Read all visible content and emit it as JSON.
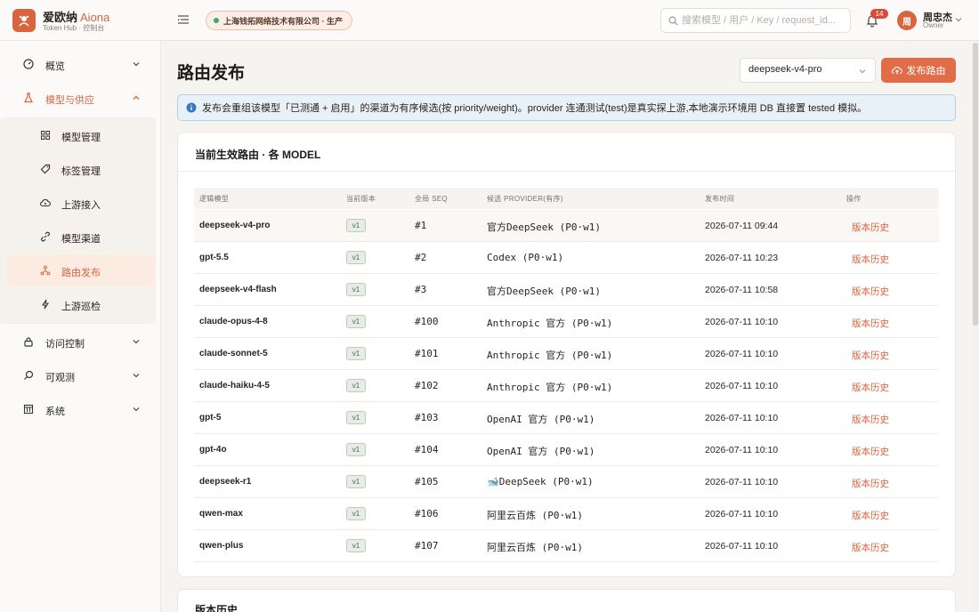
{
  "app": {
    "brand_cn": "爱欧纳",
    "brand_en": "Aiona",
    "subtitle": "Token Hub · 控制台"
  },
  "header": {
    "env_label": "上海钱拓网络技术有限公司 · 生产",
    "search_placeholder": "搜索模型 / 用户 / Key / request_id...",
    "notification_count": "14",
    "user_initial": "周",
    "user_name": "周忠杰",
    "user_role": "Owner"
  },
  "sidebar": {
    "items": [
      {
        "label": "概览",
        "icon": "dashboard-icon"
      },
      {
        "label": "模型与供应",
        "icon": "flask-icon"
      },
      {
        "label": "访问控制",
        "icon": "lock-icon"
      },
      {
        "label": "可观测",
        "icon": "search-icon"
      },
      {
        "label": "系统",
        "icon": "grid-icon"
      }
    ],
    "sub_items": [
      {
        "label": "模型管理",
        "icon": "grid-icon"
      },
      {
        "label": "标签管理",
        "icon": "tag-icon"
      },
      {
        "label": "上游接入",
        "icon": "cloud-icon"
      },
      {
        "label": "模型渠道",
        "icon": "link-icon"
      },
      {
        "label": "路由发布",
        "icon": "route-icon"
      },
      {
        "label": "上游巡检",
        "icon": "bolt-icon"
      }
    ]
  },
  "main": {
    "title": "路由发布",
    "selected_model": "deepseek-v4-pro",
    "publish_label": "发布路由",
    "info_text": "发布会重组该模型「已测通 + 启用」的渠道为有序候选(按 priority/weight)。provider 连通测试(test)是真实探上游,本地演示环境用 DB 直接置 tested 模拟。",
    "card_title": "当前生效路由 · 各 MODEL",
    "columns": [
      "逻辑模型",
      "当前版本",
      "全局 SEQ",
      "候选 PROVIDER(有序)",
      "发布时间",
      "操作"
    ],
    "rows": [
      {
        "model": "deepseek-v4-pro",
        "version": "v1",
        "seq": "#1",
        "provider": "官方DeepSeek (P0·w1)",
        "time": "2026-07-11 09:44",
        "action": "版本历史"
      },
      {
        "model": "gpt-5.5",
        "version": "v1",
        "seq": "#2",
        "provider": "Codex (P0·w1)",
        "time": "2026-07-11 10:23",
        "action": "版本历史"
      },
      {
        "model": "deepseek-v4-flash",
        "version": "v1",
        "seq": "#3",
        "provider": "官方DeepSeek (P0·w1)",
        "time": "2026-07-11 10:58",
        "action": "版本历史"
      },
      {
        "model": "claude-opus-4-8",
        "version": "v1",
        "seq": "#100",
        "provider": "Anthropic 官方 (P0·w1)",
        "time": "2026-07-11 10:10",
        "action": "版本历史"
      },
      {
        "model": "claude-sonnet-5",
        "version": "v1",
        "seq": "#101",
        "provider": "Anthropic 官方 (P0·w1)",
        "time": "2026-07-11 10:10",
        "action": "版本历史"
      },
      {
        "model": "claude-haiku-4-5",
        "version": "v1",
        "seq": "#102",
        "provider": "Anthropic 官方 (P0·w1)",
        "time": "2026-07-11 10:10",
        "action": "版本历史"
      },
      {
        "model": "gpt-5",
        "version": "v1",
        "seq": "#103",
        "provider": "OpenAI 官方 (P0·w1)",
        "time": "2026-07-11 10:10",
        "action": "版本历史"
      },
      {
        "model": "gpt-4o",
        "version": "v1",
        "seq": "#104",
        "provider": "OpenAI 官方 (P0·w1)",
        "time": "2026-07-11 10:10",
        "action": "版本历史"
      },
      {
        "model": "deepseek-r1",
        "version": "v1",
        "seq": "#105",
        "provider": "🐋DeepSeek (P0·w1)",
        "time": "2026-07-11 10:10",
        "action": "版本历史"
      },
      {
        "model": "qwen-max",
        "version": "v1",
        "seq": "#106",
        "provider": "阿里云百炼 (P0·w1)",
        "time": "2026-07-11 10:10",
        "action": "版本历史"
      },
      {
        "model": "qwen-plus",
        "version": "v1",
        "seq": "#107",
        "provider": "阿里云百炼 (P0·w1)",
        "time": "2026-07-11 10:10",
        "action": "版本历史"
      }
    ],
    "history_title": "版本历史"
  },
  "colors": {
    "accent": "#d9653f",
    "info_bg": "#e9f1f8",
    "badge_green": "#4b6650"
  }
}
